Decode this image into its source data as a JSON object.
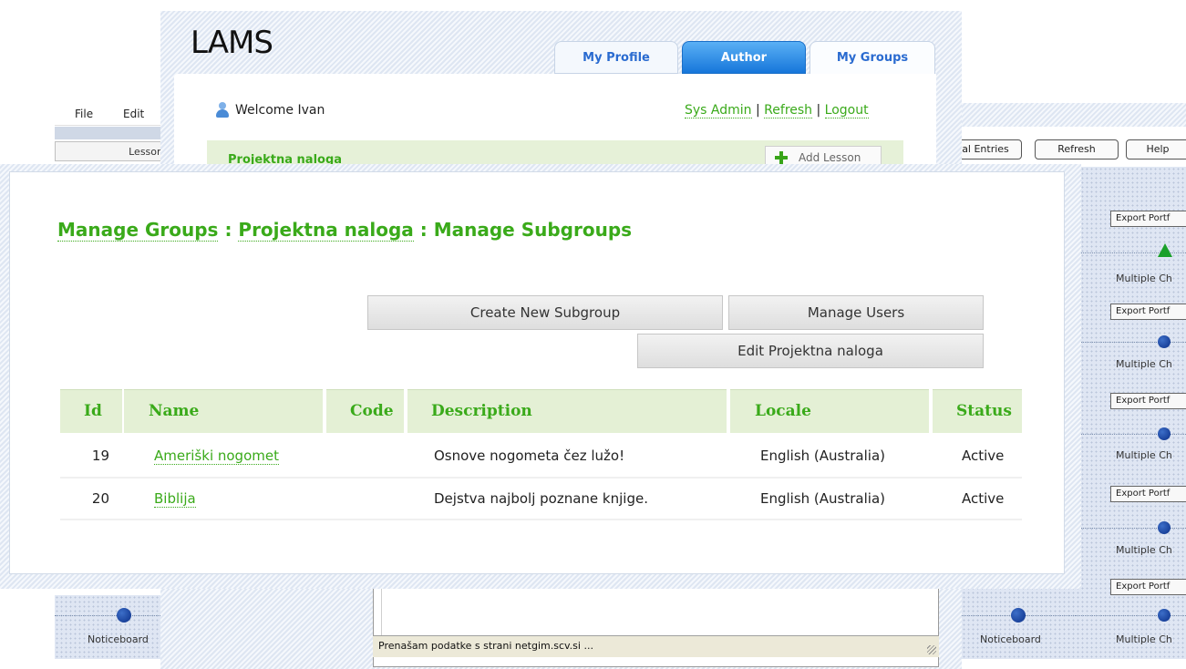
{
  "left_window": {
    "menu": [
      "File",
      "Edit"
    ],
    "tab_label": "Lesson",
    "notice_label": "Noticeboard"
  },
  "right_window": {
    "buttons": [
      "al Entries",
      "Refresh",
      "Help"
    ],
    "export_label": "Export Portf",
    "activity_label": "Multiple Ch",
    "notice_label": "Noticeboard",
    "notice_activity_label": "Multiple Ch"
  },
  "lams": {
    "logo": "LAMS",
    "tabs": [
      "My Profile",
      "Author",
      "My Groups"
    ],
    "welcome": "Welcome Ivan",
    "links": [
      "Sys Admin",
      "Refresh",
      "Logout"
    ],
    "course_title": "Projektna naloga",
    "add_lesson": "Add Lesson",
    "status_text": "Prenašam podatke s strani netgim.scv.si ..."
  },
  "dialog": {
    "breadcrumb": [
      "Manage Groups",
      "Projektna naloga",
      "Manage Subgroups"
    ],
    "separator": ":",
    "buttons": {
      "create": "Create New Subgroup",
      "users": "Manage Users",
      "edit": "Edit Projektna naloga"
    },
    "table": {
      "headers": [
        "Id",
        "Name",
        "Code",
        "Description",
        "Locale",
        "Status"
      ],
      "rows": [
        {
          "id": "19",
          "name": "Ameriški nogomet",
          "code": "",
          "description": "Osnove nogometa čez lužo!",
          "locale": "English (Australia)",
          "status": "Active"
        },
        {
          "id": "20",
          "name": "Biblija",
          "code": "",
          "description": "Dejstva najbolj poznane knjige.",
          "locale": "English (Australia)",
          "status": "Active"
        }
      ]
    }
  },
  "colors": {
    "accent_green": "#3aaa1a",
    "header_bg": "#e4f0d5",
    "tab_blue": "#1676da"
  }
}
